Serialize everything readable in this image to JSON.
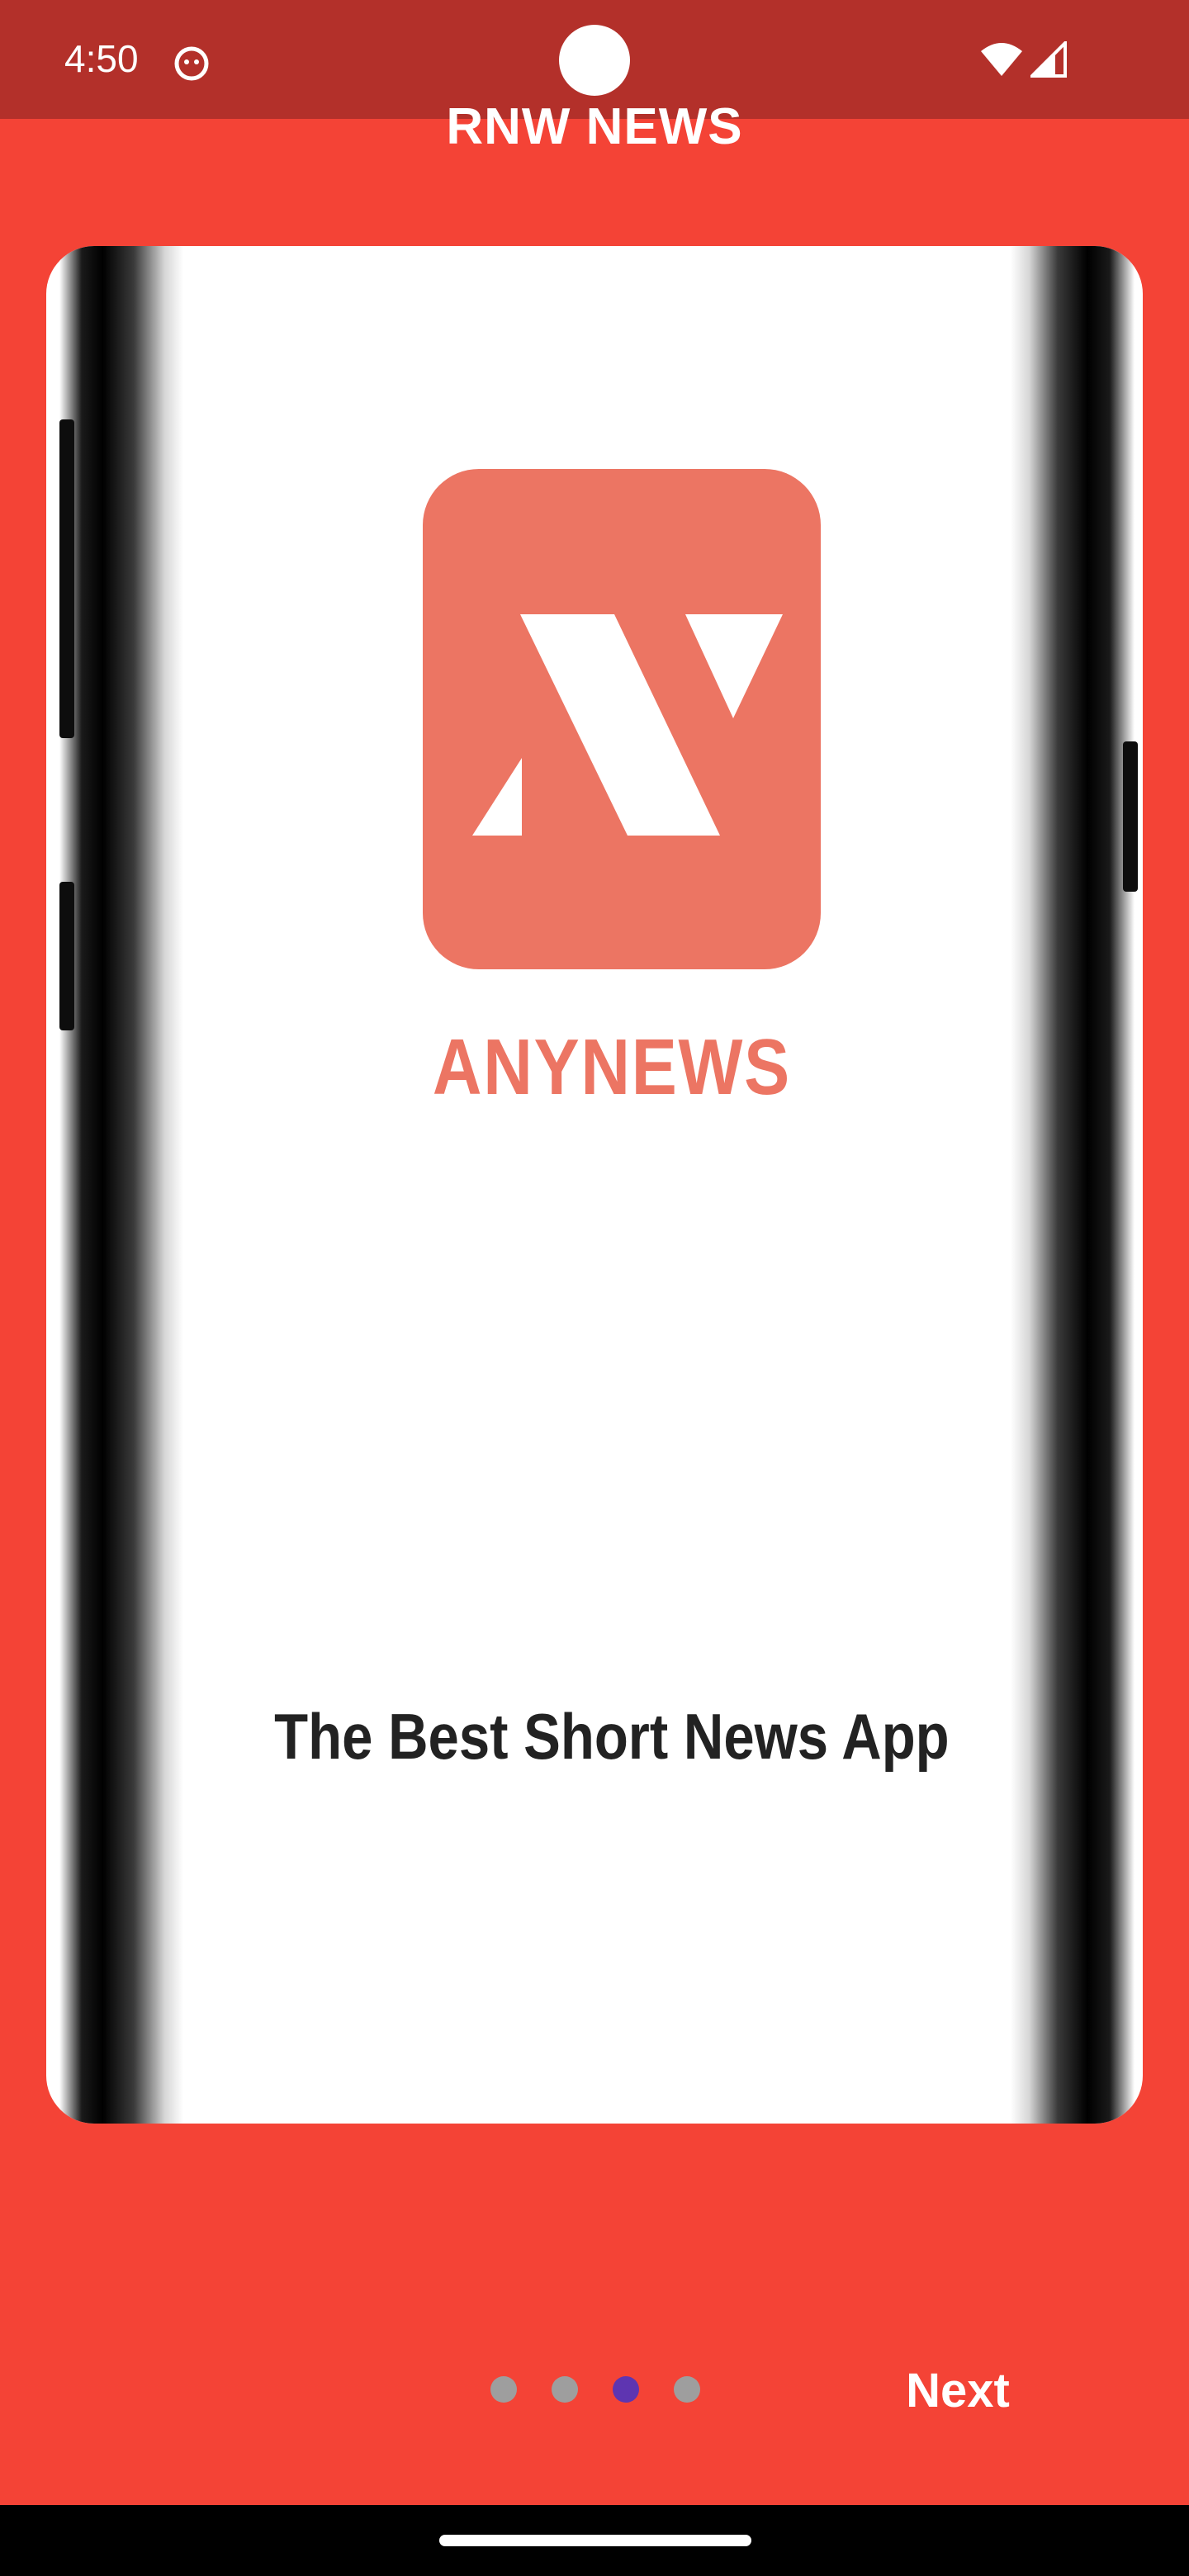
{
  "status_bar": {
    "time": "4:50",
    "icons": [
      "app-notification-icon",
      "wifi-icon",
      "cellular-signal-icon"
    ]
  },
  "app": {
    "title": "RNW NEWS"
  },
  "onboarding": {
    "slide": {
      "brand_name": "ANYNEWS",
      "tagline": "The Best Short News App",
      "logo_color": "#EC7563"
    },
    "page_count": 4,
    "active_page": 3,
    "next_label": "Next"
  },
  "colors": {
    "background": "#F44336",
    "status_bar": "#B3302A",
    "dot_inactive": "#9E9E9E",
    "dot_active": "#5E35B1"
  }
}
